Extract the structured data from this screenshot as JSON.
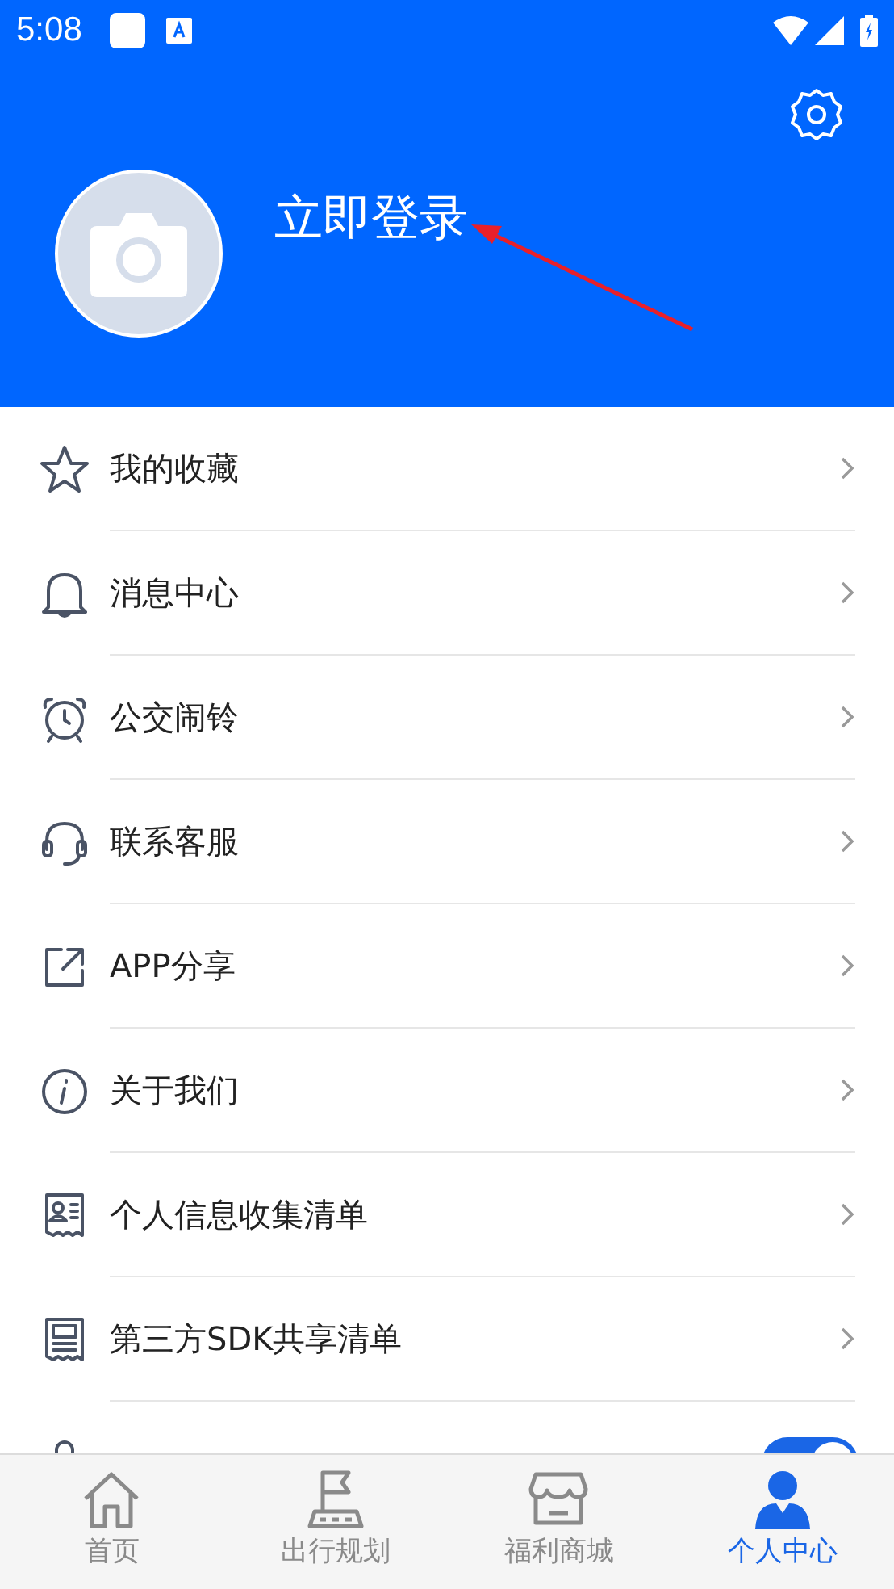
{
  "status_bar": {
    "time": "5:08"
  },
  "header": {
    "login": "立即登录"
  },
  "menu": [
    {
      "kind": "link",
      "label": "我的收藏"
    },
    {
      "kind": "link",
      "label": "消息中心"
    },
    {
      "kind": "link",
      "label": "公交闹铃"
    },
    {
      "kind": "link",
      "label": "联系客服"
    },
    {
      "kind": "link",
      "label": "APP分享"
    },
    {
      "kind": "link",
      "label": "关于我们"
    },
    {
      "kind": "link",
      "label": "个人信息收集清单"
    },
    {
      "kind": "link",
      "label": "第三方SDK共享清单"
    },
    {
      "kind": "toggle",
      "on": true
    }
  ],
  "tabs": [
    {
      "label": "首页",
      "selected": false
    },
    {
      "label": "出行规划",
      "selected": false
    },
    {
      "label": "福利商城",
      "selected": false
    },
    {
      "label": "个人中心",
      "selected": true
    }
  ]
}
